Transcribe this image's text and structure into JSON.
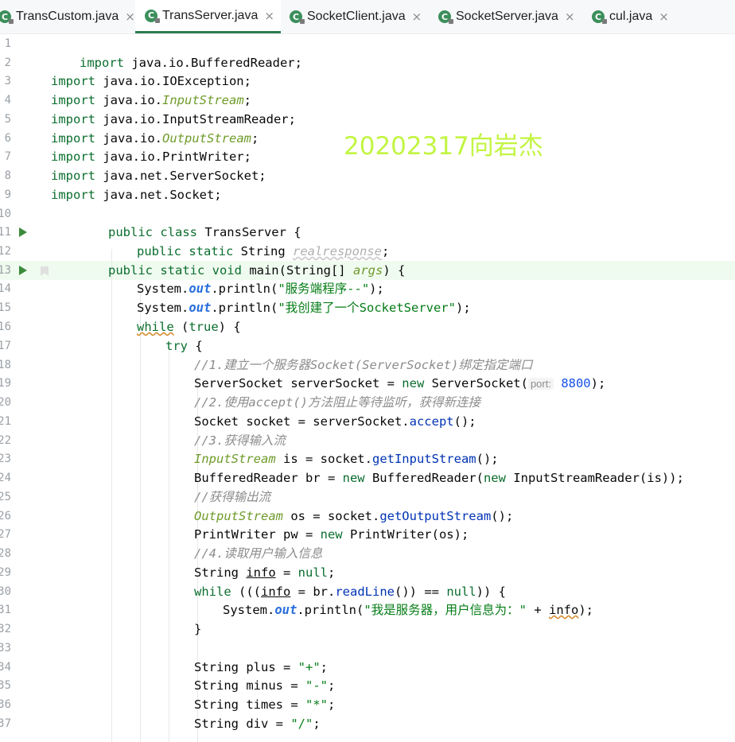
{
  "tabs": [
    {
      "label": "TransCustom.java",
      "icon": "java-class-icon",
      "active": false
    },
    {
      "label": "TransServer.java",
      "icon": "java-class-icon",
      "active": true
    },
    {
      "label": "SocketClient.java",
      "icon": "java-class-icon",
      "active": false
    },
    {
      "label": "SocketServer.java",
      "icon": "java-class-icon",
      "active": false
    },
    {
      "label": "cul.java",
      "icon": "java-class-icon",
      "active": false
    }
  ],
  "tab_close_glyph": "×",
  "watermark": "20202317向岩杰",
  "line_numbers": [
    "1",
    "2",
    "3",
    "4",
    "5",
    "6",
    "7",
    "8",
    "9",
    "10",
    "11",
    "12",
    "13",
    "14",
    "15",
    "16",
    "17",
    "18",
    "19",
    "20",
    "21",
    "22",
    "23",
    "24",
    "25",
    "26",
    "27",
    "28",
    "29",
    "30",
    "31",
    "32",
    "33",
    "34",
    "35",
    "36",
    "37"
  ],
  "code": {
    "l2": {
      "kw": "import",
      "rest": " java.io.BufferedReader;"
    },
    "l3": {
      "kw": "import",
      "rest": " java.io.IOException;"
    },
    "l4": {
      "kw": "import",
      "pre": " java.io.",
      "it": "InputStream",
      "post": ";"
    },
    "l5": {
      "kw": "import",
      "rest": " java.io.InputStreamReader;"
    },
    "l6": {
      "kw": "import",
      "pre": " java.io.",
      "it": "OutputStream",
      "post": ";"
    },
    "l7": {
      "kw": "import",
      "rest": " java.io.PrintWriter;"
    },
    "l8": {
      "kw": "import",
      "rest": " java.net.ServerSocket;"
    },
    "l9": {
      "kw": "import",
      "rest": " java.net.Socket;"
    },
    "l11": {
      "kw": "public class",
      "rest": " TransServer {"
    },
    "l12": {
      "kw": "public static",
      "mid": " String ",
      "field": "realresponse",
      "post": ";"
    },
    "l13": {
      "kw": "public static void",
      "fn": " main",
      "mid": "(String[] ",
      "param": "args",
      "post": ") {"
    },
    "l14": {
      "a": "System.",
      "out": "out",
      "b": ".println(",
      "s": "\"服务端程序--\"",
      "c": ");"
    },
    "l15": {
      "a": "System.",
      "out": "out",
      "b": ".println(",
      "s": "\"我创建了一个SocketServer\"",
      "c": ");"
    },
    "l16": {
      "kw": "while",
      "mid": " (",
      "kw2": "true",
      "post": ") {"
    },
    "l17": {
      "kw": "try",
      "post": " {"
    },
    "l18": {
      "comment": "//1.建立一个服务器Socket(ServerSocket)绑定指定端口"
    },
    "l19": {
      "a": "ServerSocket serverSocket = ",
      "kw": "new",
      "b": " ServerSocket(",
      "hint": "port:",
      "num": "8800",
      "c": ");"
    },
    "l20": {
      "comment": "//2.使用accept()方法阻止等待监听，获得新连接"
    },
    "l21": {
      "a": "Socket socket = serverSocket.",
      "fn": "accept",
      "c": "();"
    },
    "l22": {
      "comment": "//3.获得输入流"
    },
    "l23": {
      "it": "InputStream",
      "a": " is = socket.",
      "fn": "getInputStream",
      "c": "();"
    },
    "l24": {
      "a": "BufferedReader br = ",
      "kw": "new",
      "b": " BufferedReader(",
      "kw2": "new",
      "c": " InputStreamReader(is));"
    },
    "l25": {
      "comment": "//获得输出流"
    },
    "l26": {
      "it": "OutputStream",
      "a": " os = socket.",
      "fn": "getOutputStream",
      "c": "();"
    },
    "l27": {
      "a": "PrintWriter pw = ",
      "kw": "new",
      "b": " PrintWriter(os);"
    },
    "l28": {
      "comment": "//4.读取用户输入信息"
    },
    "l29": {
      "a": "String ",
      "var": "info",
      "b": " = ",
      "kw": "null",
      "c": ";"
    },
    "l30": {
      "kw": "while",
      "a": " (((",
      "var": "info",
      "b": " = br.",
      "fn": "readLine",
      "c": "()) ",
      "op": "==",
      "d": " ",
      "kw2": "null",
      "e": ")) {"
    },
    "l31": {
      "a": "System.",
      "out": "out",
      "b": ".println(",
      "s": "\"我是服务器，用户信息为：\"",
      "c": " + ",
      "var": "info",
      "d": ");"
    },
    "l32": {
      "a": "}"
    },
    "l34": {
      "a": "String plus = ",
      "s": "\"+\"",
      "c": ";"
    },
    "l35": {
      "a": "String minus = ",
      "s": "\"-\"",
      "c": ";"
    },
    "l36": {
      "a": "String times = ",
      "s": "\"*\"",
      "c": ";"
    },
    "l37": {
      "a": "String div = ",
      "s": "\"/\"",
      "c": ";"
    }
  }
}
